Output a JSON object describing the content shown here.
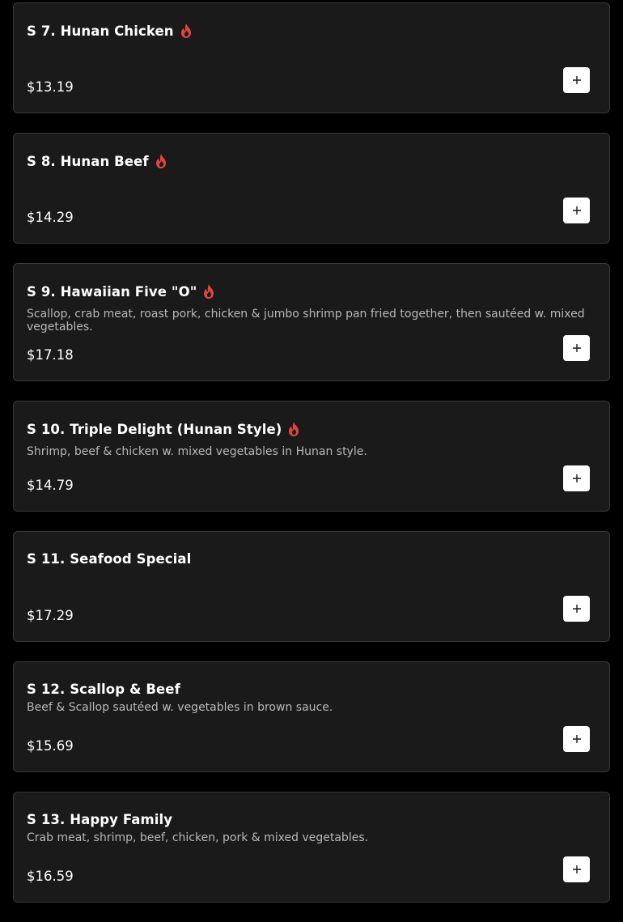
{
  "colors": {
    "background": "#000000",
    "card": "#1b1a1b",
    "card_border": "#3a393a",
    "flame": "#e2463b",
    "description": "#b8b8b8"
  },
  "items": [
    {
      "name": "S 7. Hunan Chicken",
      "spicy": true,
      "description": "",
      "price": "$13.19",
      "add_icon": "plus-icon"
    },
    {
      "name": "S 8. Hunan Beef",
      "spicy": true,
      "description": "",
      "price": "$14.29",
      "add_icon": "plus-icon"
    },
    {
      "name": "S 9. Hawaiian Five \"O\"",
      "spicy": true,
      "description": "Scallop, crab meat, roast pork, chicken & jumbo shrimp pan fried together, then sautéed w. mixed vegetables.",
      "price": "$17.18",
      "add_icon": "plus-icon"
    },
    {
      "name": "S 10. Triple Delight (Hunan Style)",
      "spicy": true,
      "description": "Shrimp, beef & chicken w. mixed vegetables in Hunan style.",
      "price": "$14.79",
      "add_icon": "plus-icon"
    },
    {
      "name": "S 11. Seafood Special",
      "spicy": false,
      "description": "",
      "price": "$17.29",
      "add_icon": "plus-icon"
    },
    {
      "name": "S 12. Scallop & Beef",
      "spicy": false,
      "description": "Beef & Scallop sautéed w. vegetables in brown sauce.",
      "price": "$15.69",
      "add_icon": "plus-icon"
    },
    {
      "name": "S 13. Happy Family",
      "spicy": false,
      "description": "Crab meat, shrimp, beef, chicken, pork & mixed vegetables.",
      "price": "$16.59",
      "add_icon": "plus-icon"
    }
  ]
}
